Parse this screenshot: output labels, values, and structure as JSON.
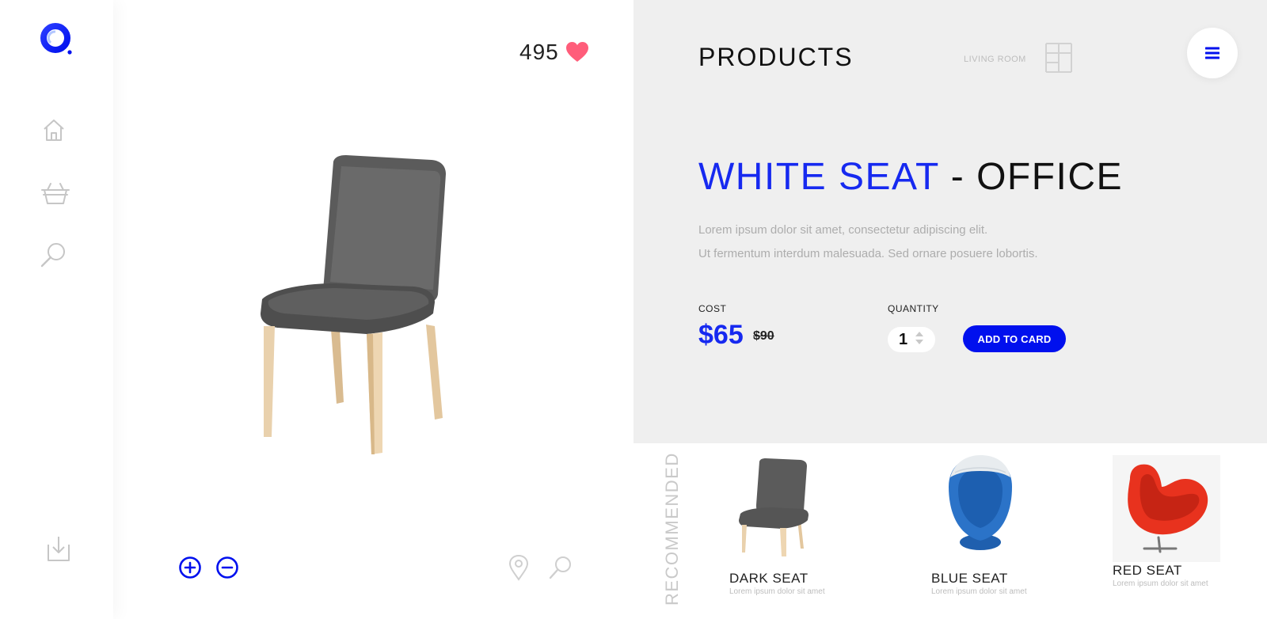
{
  "brand": {
    "accent_color": "#1629f0",
    "button_color": "#0010ee",
    "heart_color": "#ff5d7a"
  },
  "sidebar": {
    "logo_icon": "ring-logo-icon",
    "items": [
      {
        "icon": "home-icon"
      },
      {
        "icon": "basket-icon"
      },
      {
        "icon": "search-icon"
      }
    ],
    "bottom_icon": "download-icon"
  },
  "stage": {
    "likes": "495",
    "like_icon": "heart-icon",
    "zoom_in_icon": "zoom-in-icon",
    "zoom_out_icon": "zoom-out-icon",
    "location_icon": "location-pin-icon",
    "search_icon": "search-icon"
  },
  "header": {
    "title": "PRODUCTS",
    "category": "LIVING ROOM",
    "category_icon": "shelf-icon",
    "menu_icon": "hamburger-menu-icon"
  },
  "product": {
    "name_accent": "WHITE SEAT",
    "name_rest": " - OFFICE",
    "description_line1": "Lorem ipsum dolor sit amet, consectetur adipiscing elit.",
    "description_line2": "Ut fermentum interdum malesuada. Sed ornare posuere lobortis.",
    "cost_label": "COST",
    "price": "$65",
    "old_price": "$90",
    "quantity_label": "QUANTITY",
    "quantity": "1",
    "add_button": "ADD TO CARD"
  },
  "recommended": {
    "label": "RECOMMENDED",
    "items": [
      {
        "name": "DARK SEAT",
        "desc": "Lorem ipsum dolor sit amet"
      },
      {
        "name": "BLUE SEAT",
        "desc": "Lorem ipsum dolor sit amet"
      },
      {
        "name": "RED SEAT",
        "desc": "Lorem ipsum dolor sit amet"
      }
    ]
  }
}
